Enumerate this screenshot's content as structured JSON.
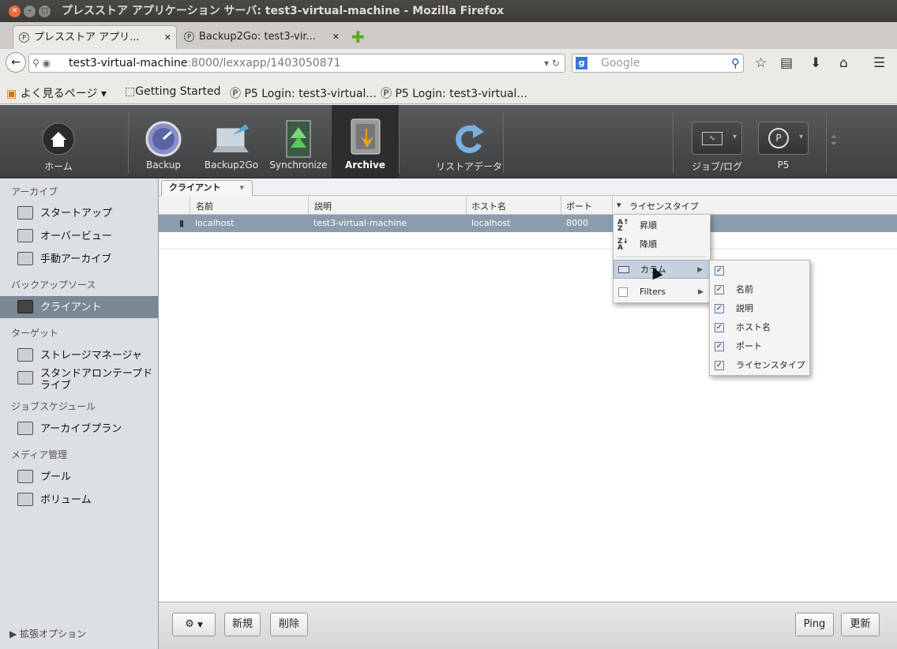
{
  "window": {
    "title": "プレスストア アプリケーション サーバ: test3-virtual-machine - Mozilla Firefox"
  },
  "browser": {
    "tabs": [
      {
        "label": "プレスストア アプリ..."
      },
      {
        "label": "Backup2Go: test3-vir..."
      }
    ],
    "url": {
      "host": "test3-virtual-machine",
      "rest": ":8000/lexxapp/1403050871"
    },
    "search_placeholder": "Google",
    "bookmarks": [
      "よく見るページ ▾",
      "Getting Started",
      "P5 Login: test3-virtual...",
      "P5 Login: test3-virtual..."
    ]
  },
  "toolbar": {
    "items": [
      {
        "label": "ホーム"
      },
      {
        "label": "Backup"
      },
      {
        "label": "Backup2Go"
      },
      {
        "label": "Synchronize"
      },
      {
        "label": "Archive"
      },
      {
        "label": "リストアデータ"
      },
      {
        "label": "ジョブ/ログ"
      },
      {
        "label": "P5"
      }
    ]
  },
  "sidebar": {
    "sections": [
      {
        "title": "アーカイブ",
        "items": [
          "スタートアップ",
          "オーバービュー",
          "手動アーカイブ"
        ]
      },
      {
        "title": "バックアップソース",
        "items": [
          "クライアント"
        ]
      },
      {
        "title": "ターゲット",
        "items": [
          "ストレージマネージャ",
          "スタンドアロンテープドライブ"
        ]
      },
      {
        "title": "ジョブスケジュール",
        "items": [
          "アーカイブプラン"
        ]
      },
      {
        "title": "メディア管理",
        "items": [
          "プール",
          "ボリューム"
        ]
      }
    ],
    "footer": "拡張オプション"
  },
  "main": {
    "tab_label": "クライアント",
    "columns": [
      "名前",
      "説明",
      "ホスト名",
      "ポート",
      "ライセンスタイプ"
    ],
    "rows": [
      {
        "name": "localhost",
        "description": "test3-virtual-machine",
        "host": "localhost",
        "port": "8000",
        "license": ""
      }
    ]
  },
  "column_menu": {
    "items": [
      {
        "label": "昇順",
        "icon": "sort-asc-icon"
      },
      {
        "label": "降順",
        "icon": "sort-desc-icon"
      },
      {
        "label": "カラム",
        "icon": "columns-icon"
      },
      {
        "label": "Filters",
        "icon": "filter-checkbox"
      }
    ]
  },
  "columns_submenu": {
    "items": [
      {
        "label": "",
        "checked": true
      },
      {
        "label": "名前",
        "checked": true
      },
      {
        "label": "説明",
        "checked": true
      },
      {
        "label": "ホスト名",
        "checked": true
      },
      {
        "label": "ポート",
        "checked": true
      },
      {
        "label": "ライセンスタイプ",
        "checked": true
      }
    ]
  },
  "bottom": {
    "buttons": [
      "新規",
      "削除",
      "Ping",
      "更新"
    ]
  }
}
